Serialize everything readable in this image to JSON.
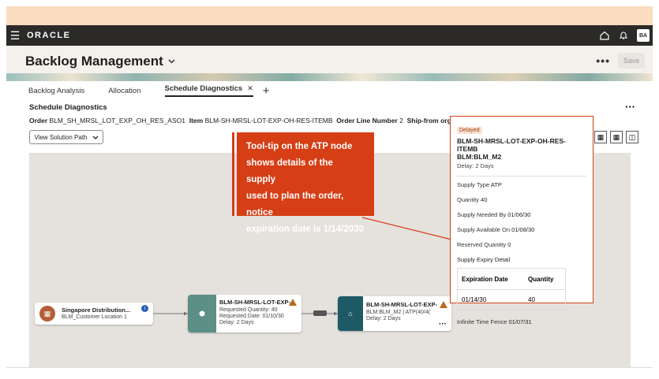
{
  "topbar": {
    "menu_icon": "hamburger-icon",
    "logo": "ORACLE",
    "avatar": "BA"
  },
  "header": {
    "title": "Backlog Management",
    "more_label": "•••",
    "save_label": "Save"
  },
  "tabs": [
    {
      "label": "Backlog Analysis"
    },
    {
      "label": "Allocation"
    },
    {
      "label": "Schedule Diagnostics",
      "active": true
    }
  ],
  "section": {
    "title": "Schedule Diagnostics",
    "order_label": "Order",
    "order_value": "BLM_SH_MRSL_LOT_EXP_OH_RES_ASO1",
    "item_label": "Item",
    "item_value": "BLM-SH-MRSL-LOT-EXP-OH-RES-ITEMB",
    "line_label": "Order Line Number",
    "line_value": "2",
    "shipfrom_label": "Ship-from orga",
    "view_button": "View Solution Path"
  },
  "callout": {
    "line1": "Tool-tip on the ATP node",
    "line2": "shows details of the supply",
    "line3": "used to plan the order, notice",
    "line4": "expiration date is 1/14/2030"
  },
  "nodes": {
    "customer": {
      "title": "Singapore Distribution...",
      "subtitle": "BLM_Customer Location 1"
    },
    "item": {
      "title": "BLM-SH-MRSL-LOT-EXP-",
      "line1": "Requested Quantity: 40",
      "line2": "Requested Date: 01/10/30",
      "line3": "Delay: 2 Days"
    },
    "atp": {
      "title": "BLM-SH-MRSL-LOT-EXP-",
      "line1": "BLM:BLM_M2 | ATP(40/4(",
      "line2": "Delay: 2 Days"
    }
  },
  "tooltip": {
    "badge": "Delayed",
    "title_line1": "BLM-SH-MRSL-LOT-EXP-OH-RES-ITEMB",
    "title_line2": "BLM:BLM_M2",
    "delay": "Delay: 2 Days",
    "supply_type_label": "Supply Type",
    "supply_type_value": "ATP",
    "quantity_label": "Quantity",
    "quantity_value": "40",
    "needed_label": "Supply Needed By",
    "needed_value": "01/06/30",
    "available_label": "Supply Available On",
    "available_value": "01/08/30",
    "reserved_label": "Reserved Quantity",
    "reserved_value": "0",
    "expiry_label": "Supply Expiry Detail",
    "table_headers": [
      "Expiration Date",
      "Quantity"
    ],
    "table_rows": [
      [
        "01/14/30",
        "40"
      ]
    ],
    "fence_label": "Infinite Time Fence",
    "fence_value": "01/07/31"
  },
  "colors": {
    "accent": "#d63e15",
    "topbar": "#2b2a28",
    "canvas": "#e5e2dd"
  }
}
